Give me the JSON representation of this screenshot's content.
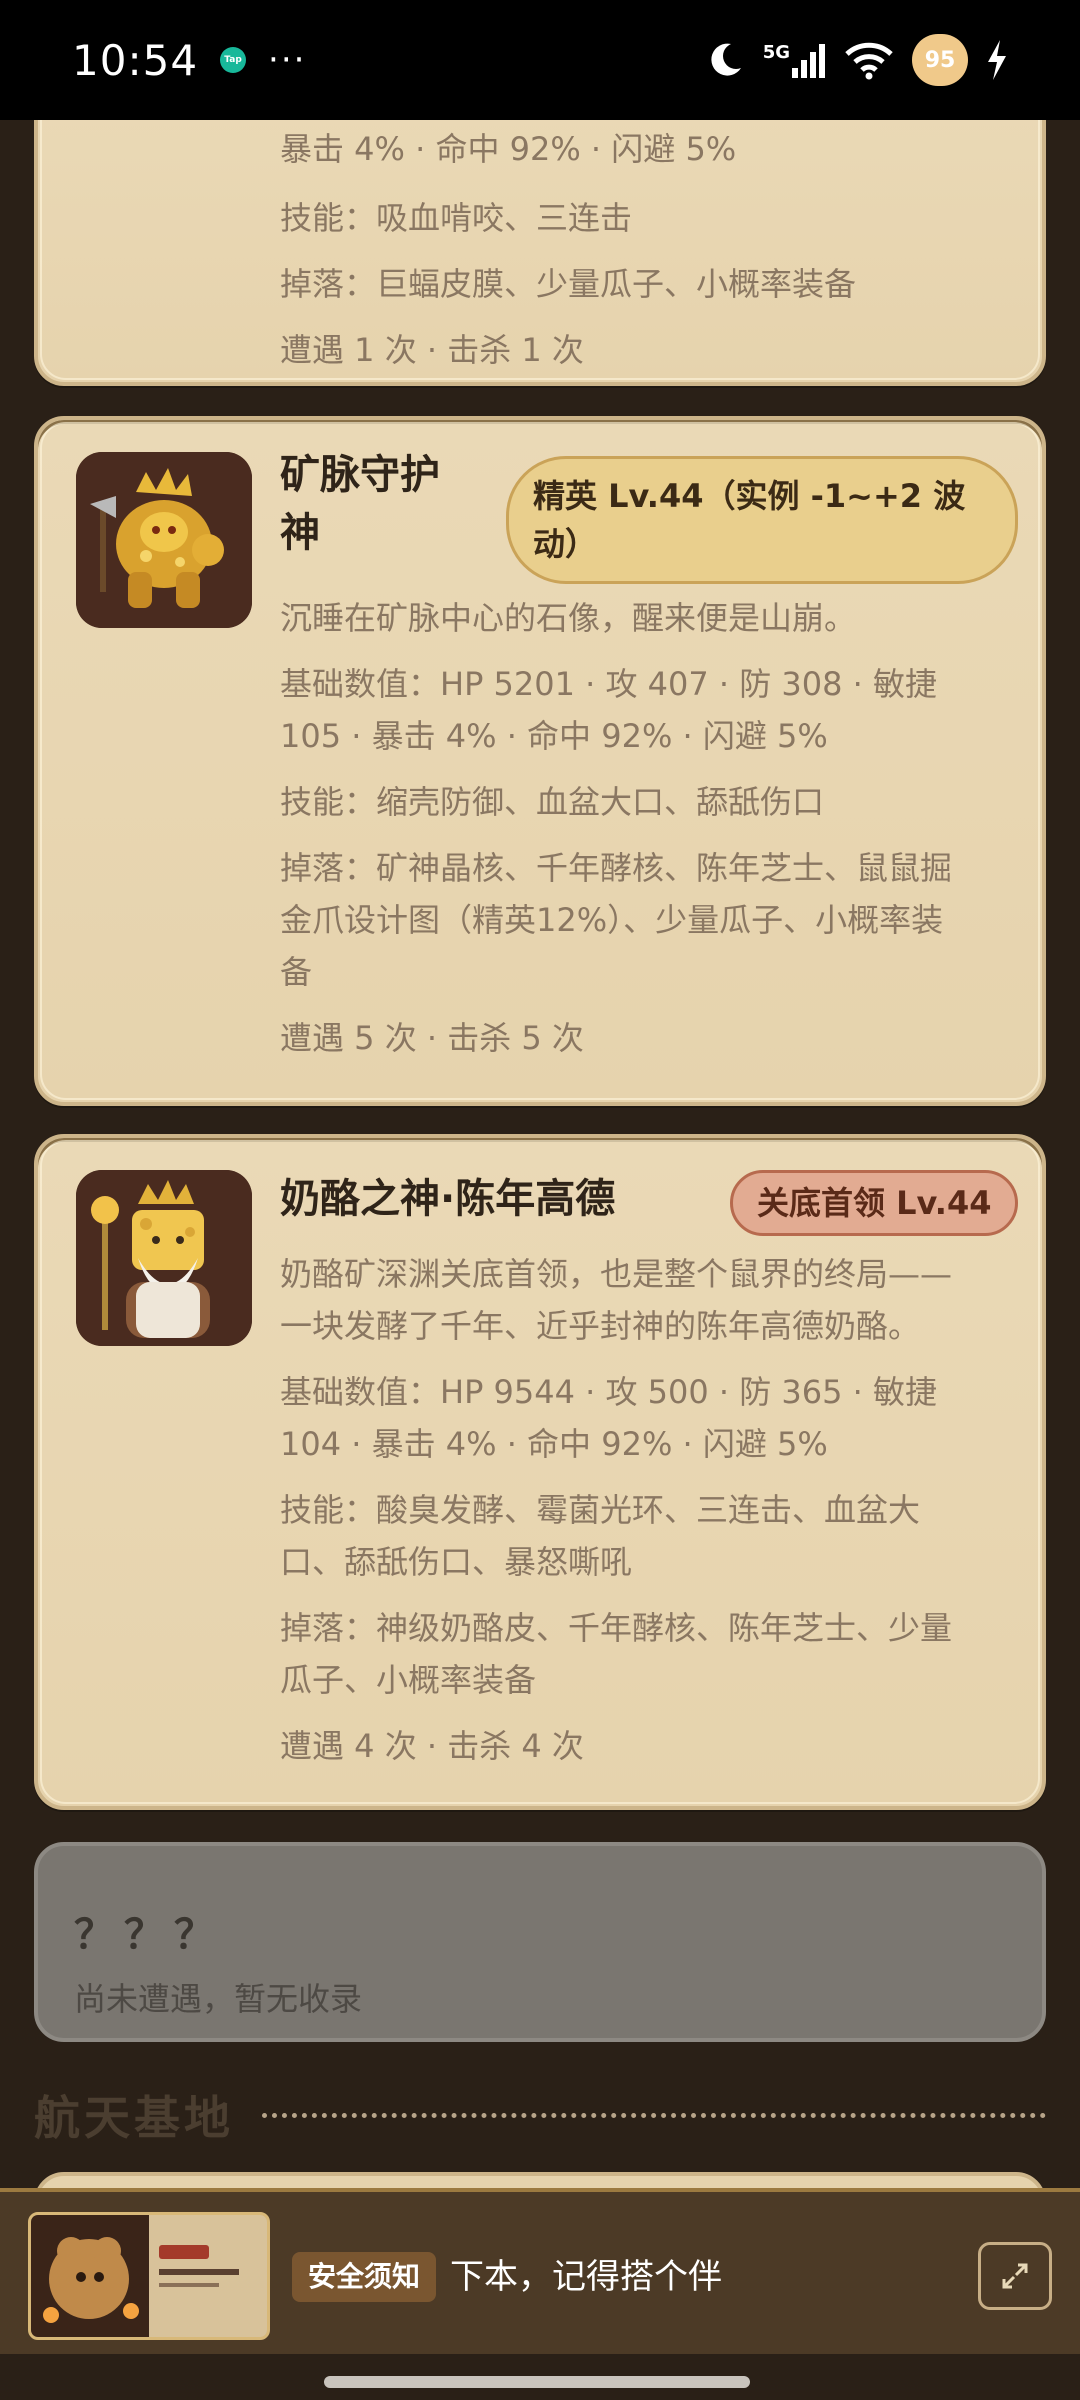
{
  "status_bar": {
    "time": "10:54",
    "app_icon": "tap-icon",
    "more": "···",
    "network": "5G",
    "battery": "95"
  },
  "cards": [
    {
      "stats_tail": "暴击 4% · 命中 92% · 闪避 5%",
      "skills": "技能：吸血啃咬、三连击",
      "drops": "掉落：巨蝠皮膜、少量瓜子、小概率装备",
      "encounters": "遭遇 1 次 · 击杀 1 次"
    },
    {
      "name_line1": "矿脉守护",
      "name_line2": "神",
      "tag": "精英 Lv.44（实例 -1~+2 波",
      "tag_line2": "动）",
      "desc": "沉睡在矿脉中心的石像，醒来便是山崩。",
      "stats_line1": "基础数值：HP 5201 · 攻 407 · 防 308 · 敏捷",
      "stats_line2": "105 · 暴击 4% · 命中 92% · 闪避 5%",
      "skills": "技能：缩壳防御、血盆大口、舔舐伤口",
      "drops_line1": "掉落：矿神晶核、千年酵核、陈年芝士、鼠鼠掘",
      "drops_line2": "金爪设计图（精英12%）、少量瓜子、小概率装",
      "drops_line3": "备",
      "encounters": "遭遇 5 次 · 击杀 5 次"
    },
    {
      "name": "奶酪之神·陈年高德",
      "tag": "关底首领 Lv.44",
      "desc_line1": "奶酪矿深渊关底首领，也是整个鼠界的终局——",
      "desc_line2": "一块发酵了千年、近乎封神的陈年高德奶酪。",
      "stats_line1": "基础数值：HP 9544 · 攻 500 · 防 365 · 敏捷",
      "stats_line2": "104 · 暴击 4% · 命中 92% · 闪避 5%",
      "skills_line1": "技能：酸臭发酵、霉菌光环、三连击、血盆大",
      "skills_line2": "口、舔舐伤口、暴怒嘶吼",
      "drops_line1": "掉落：神级奶酪皮、千年酵核、陈年芝士、少量",
      "drops_line2": "瓜子、小概率装备",
      "encounters": "遭遇 4 次 · 击杀 4 次"
    }
  ],
  "unknown": {
    "title": "？？？",
    "subtitle": "尚未遭遇，暂无收录"
  },
  "section": {
    "title": "航天基地"
  },
  "banner": {
    "tag": "安全须知",
    "text": "下本，记得搭个伴"
  },
  "colors": {
    "background": "#2a2017",
    "card": "#e6d3ad",
    "elite_tag": "#e9cf8d",
    "boss_tag": "#e2ab92"
  }
}
